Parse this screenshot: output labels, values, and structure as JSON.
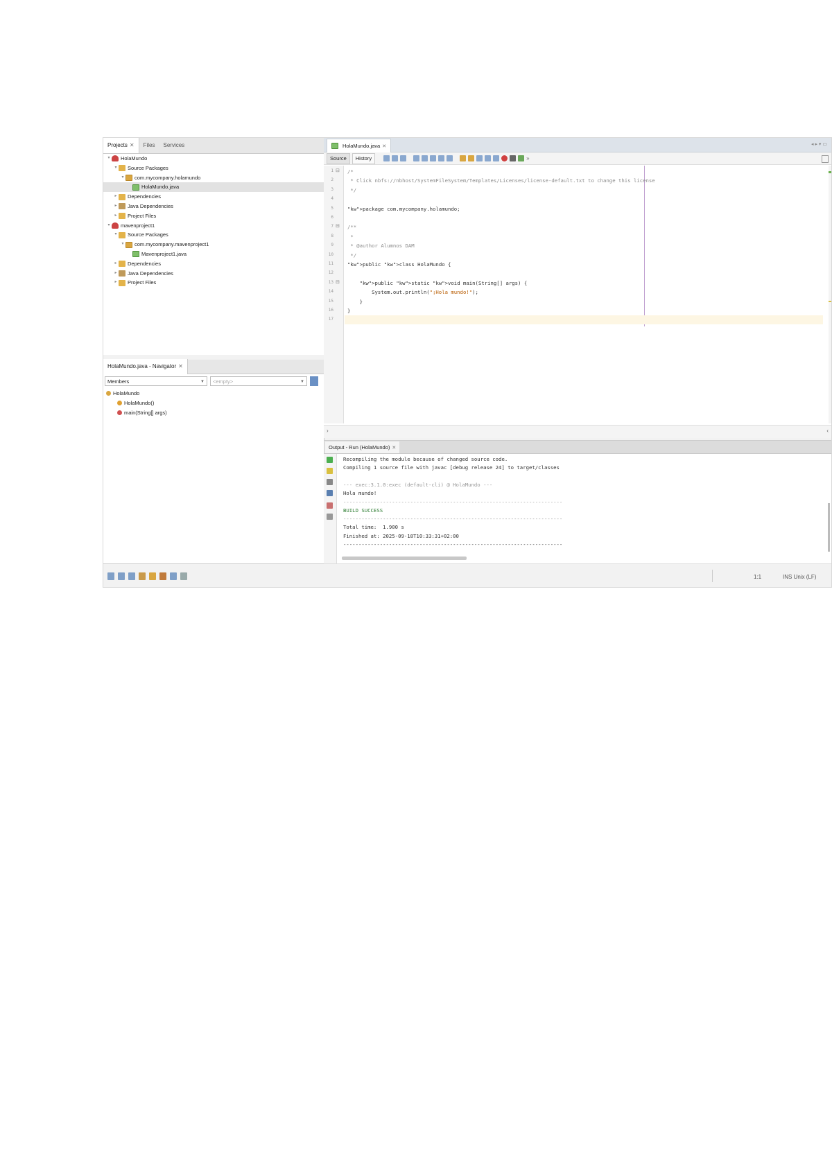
{
  "projects_panel": {
    "tabs": [
      "Projects",
      "Files",
      "Services"
    ],
    "tree": [
      {
        "label": "HolaMundo",
        "depth": 0,
        "icon": "project-icon",
        "expanded": true
      },
      {
        "label": "Source Packages",
        "depth": 1,
        "icon": "folder-icon",
        "expanded": true
      },
      {
        "label": "com.mycompany.holamundo",
        "depth": 2,
        "icon": "package-icon",
        "expanded": true
      },
      {
        "label": "HolaMundo.java",
        "depth": 3,
        "icon": "java-file-icon",
        "selected": true
      },
      {
        "label": "Dependencies",
        "depth": 1,
        "icon": "folder-icon"
      },
      {
        "label": "Java Dependencies",
        "depth": 1,
        "icon": "library-icon"
      },
      {
        "label": "Project Files",
        "depth": 1,
        "icon": "folder-icon"
      },
      {
        "label": "mavenproject1",
        "depth": 0,
        "icon": "project-icon",
        "expanded": true
      },
      {
        "label": "Source Packages",
        "depth": 1,
        "icon": "folder-icon",
        "expanded": true
      },
      {
        "label": "com.mycompany.mavenproject1",
        "depth": 2,
        "icon": "package-icon",
        "expanded": true
      },
      {
        "label": "Mavenproject1.java",
        "depth": 3,
        "icon": "java-file-icon"
      },
      {
        "label": "Dependencies",
        "depth": 1,
        "icon": "folder-icon"
      },
      {
        "label": "Java Dependencies",
        "depth": 1,
        "icon": "library-icon"
      },
      {
        "label": "Project Files",
        "depth": 1,
        "icon": "folder-icon"
      }
    ]
  },
  "navigator": {
    "tab": "HolaMundo.java - Navigator",
    "members_combo": "Members",
    "filter_combo": "<empty>",
    "tree": [
      {
        "label": "HolaMundo",
        "depth": 0
      },
      {
        "label": "HolaMundo()",
        "depth": 1
      },
      {
        "label": "main(String[] args)",
        "depth": 1
      }
    ]
  },
  "editor": {
    "tab": "HolaMundo.java",
    "view_source": "Source",
    "view_history": "History",
    "lines": [
      {
        "n": "1",
        "t": "/*",
        "cls": "cm"
      },
      {
        "n": "2",
        "t": " * Click nbfs://nbhost/SystemFileSystem/Templates/Licenses/license-default.txt to change this license",
        "cls": "cm"
      },
      {
        "n": "3",
        "t": " */",
        "cls": "cm"
      },
      {
        "n": "4",
        "t": "",
        "cls": ""
      },
      {
        "n": "5",
        "t": "package com.mycompany.holamundo;",
        "cls": ""
      },
      {
        "n": "6",
        "t": "",
        "cls": ""
      },
      {
        "n": "7",
        "t": "/**",
        "cls": "cm"
      },
      {
        "n": "8",
        "t": " *",
        "cls": "cm"
      },
      {
        "n": "9",
        "t": " * @author Alumnos DAM",
        "cls": "cm"
      },
      {
        "n": "10",
        "t": " */",
        "cls": "cm"
      },
      {
        "n": "11",
        "t": "public class HolaMundo {",
        "cls": ""
      },
      {
        "n": "12",
        "t": "",
        "cls": ""
      },
      {
        "n": "13",
        "t": "    public static void main(String[] args) {",
        "cls": ""
      },
      {
        "n": "14",
        "t": "        System.out.println(\"¡Hola mundo!\");",
        "cls": ""
      },
      {
        "n": "15",
        "t": "    }",
        "cls": ""
      },
      {
        "n": "16",
        "t": "}",
        "cls": ""
      },
      {
        "n": "17",
        "t": "",
        "cls": ""
      }
    ]
  },
  "output": {
    "tab": "Output - Run (HolaMundo)",
    "lines": [
      {
        "t": "Recompiling the module because of changed source code.",
        "cls": ""
      },
      {
        "t": "Compiling 1 source file with javac [debug release 24] to target/classes",
        "cls": ""
      },
      {
        "t": "",
        "cls": ""
      },
      {
        "t": "--- exec:3.1.0:exec (default-cli) @ HolaMundo ---",
        "cls": "dim"
      },
      {
        "t": "Hola mundo!",
        "cls": ""
      },
      {
        "t": "------------------------------------------------------------------------",
        "cls": "dim"
      },
      {
        "t": "BUILD SUCCESS",
        "cls": "ok"
      },
      {
        "t": "------------------------------------------------------------------------",
        "cls": "dim"
      },
      {
        "t": "Total time:  1.900 s",
        "cls": ""
      },
      {
        "t": "Finished at: 2025-09-18T10:33:31+02:00",
        "cls": ""
      },
      {
        "t": "------------------------------------------------------------------------",
        "cls": ""
      }
    ]
  },
  "status": {
    "position": "1:1",
    "insert_mode": "INS Unix (LF)"
  }
}
